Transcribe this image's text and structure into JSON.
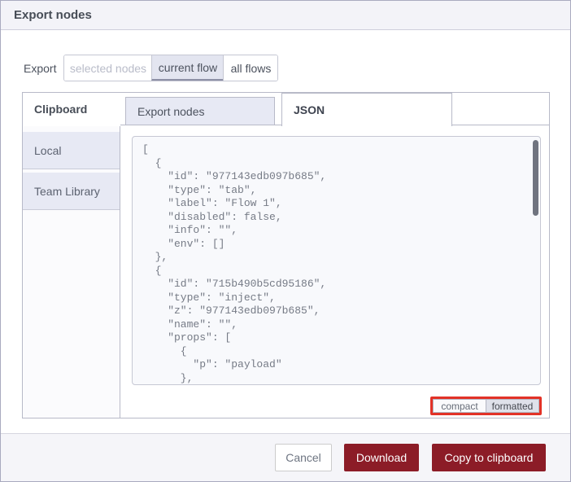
{
  "dialog": {
    "title": "Export nodes"
  },
  "export_row": {
    "label": "Export",
    "options": [
      {
        "label": "selected nodes",
        "state": "disabled"
      },
      {
        "label": "current flow",
        "state": "selected"
      },
      {
        "label": "all flows",
        "state": "default"
      }
    ]
  },
  "panel": {
    "sidebar_header": "Clipboard",
    "sidebar_items": [
      "Local",
      "Team Library"
    ],
    "tabs": [
      {
        "label": "Export nodes",
        "active": false
      },
      {
        "label": "JSON",
        "active": true
      }
    ]
  },
  "code": {
    "text": "[\n  {\n    \"id\": \"977143edb097b685\",\n    \"type\": \"tab\",\n    \"label\": \"Flow 1\",\n    \"disabled\": false,\n    \"info\": \"\",\n    \"env\": []\n  },\n  {\n    \"id\": \"715b490b5cd95186\",\n    \"type\": \"inject\",\n    \"z\": \"977143edb097b685\",\n    \"name\": \"\",\n    \"props\": [\n      {\n        \"p\": \"payload\"\n      },"
  },
  "format_toggle": {
    "compact_label": "compact",
    "formatted_label": "formatted",
    "selected": "formatted"
  },
  "footer": {
    "cancel_label": "Cancel",
    "download_label": "Download",
    "copy_label": "Copy to clipboard"
  },
  "colors": {
    "accent_maroon": "#8c1c27",
    "annotation_red": "#e23227",
    "tab_fill": "#e7e9f4",
    "header_bg": "#f3f3f8"
  }
}
